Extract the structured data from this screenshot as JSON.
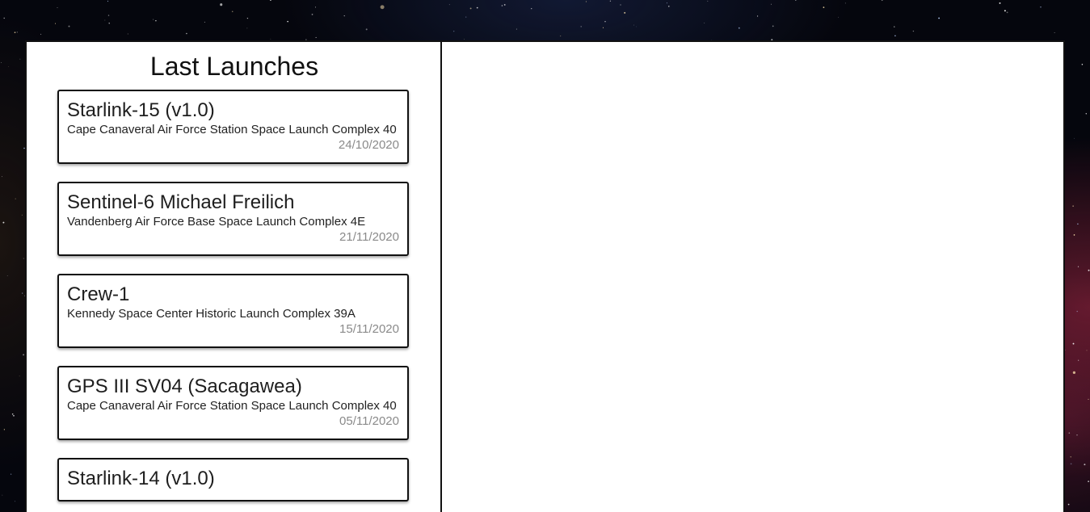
{
  "panel": {
    "title": "Last Launches"
  },
  "launches": [
    {
      "name": "Starlink-15 (v1.0)",
      "site": "Cape Canaveral Air Force Station Space Launch Complex 40",
      "date": "24/10/2020"
    },
    {
      "name": "Sentinel-6 Michael Freilich",
      "site": "Vandenberg Air Force Base Space Launch Complex 4E",
      "date": "21/11/2020"
    },
    {
      "name": "Crew-1",
      "site": "Kennedy Space Center Historic Launch Complex 39A",
      "date": "15/11/2020"
    },
    {
      "name": "GPS III SV04 (Sacagawea)",
      "site": "Cape Canaveral Air Force Station Space Launch Complex 40",
      "date": "05/11/2020"
    },
    {
      "name": "Starlink-14 (v1.0)",
      "site": "",
      "date": ""
    }
  ]
}
